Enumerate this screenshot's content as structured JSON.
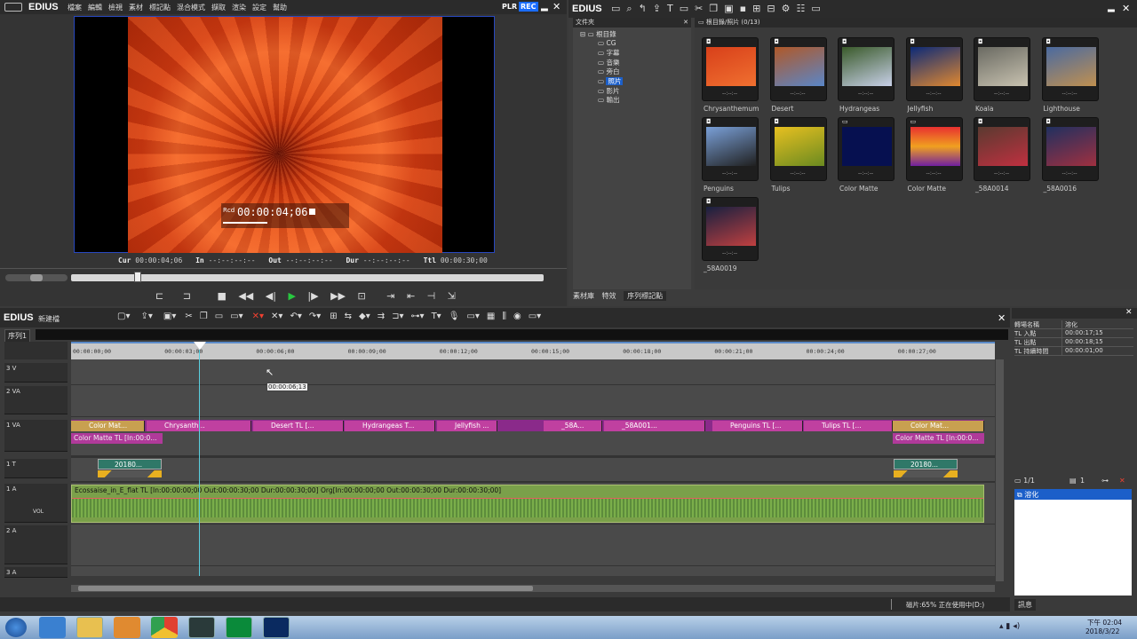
{
  "colors": {
    "accent": "#1c5fc9",
    "rec": "#1a6cff",
    "clip_pink": "#c040a0",
    "audio_green": "#7aa04a",
    "title_teal": "#3f8a7a"
  },
  "player": {
    "app_name": "EDIUS",
    "menu": [
      "檔案",
      "編輯",
      "檢視",
      "素材",
      "標記點",
      "混合模式",
      "擷取",
      "渲染",
      "設定",
      "幫助"
    ],
    "mode_plr": "PLR",
    "mode_rec": "REC",
    "overlay_label": "Rcd",
    "overlay_tc": "00:00:04;06",
    "cur_label": "Cur",
    "cur_value": "00:00:04;06",
    "in_label": "In",
    "in_value": "--:--:--:--",
    "out_label": "Out",
    "out_value": "--:--:--:--",
    "dur_label": "Dur",
    "dur_value": "--:--:--:--",
    "ttl_label": "Ttl",
    "ttl_value": "00:00:30;00"
  },
  "bin": {
    "app_name": "EDIUS",
    "folder_header": "文件夾",
    "path_header": "根目錄/照片 (0/13)",
    "tree": [
      "根目錄",
      "CG",
      "字幕",
      "音樂",
      "旁白",
      "照片",
      "影片",
      "輸出"
    ],
    "selected_folder": "照片",
    "items": [
      {
        "name": "Chrysanthemum",
        "thumb": "#d8401a",
        "thumb2": "#f07030",
        "icon": "camera-icon"
      },
      {
        "name": "Desert",
        "thumb": "#b05828",
        "thumb2": "#5a86c8",
        "icon": "camera-icon"
      },
      {
        "name": "Hydrangeas",
        "thumb": "#3a5a2a",
        "thumb2": "#c8d0e8",
        "icon": "camera-icon"
      },
      {
        "name": "Jellyfish",
        "thumb": "#0c2a78",
        "thumb2": "#e08830",
        "icon": "camera-icon"
      },
      {
        "name": "Koala",
        "thumb": "#6a6a62",
        "thumb2": "#c8c2b0",
        "icon": "camera-icon"
      },
      {
        "name": "Lighthouse",
        "thumb": "#4a6aa0",
        "thumb2": "#c09050",
        "icon": "camera-icon"
      },
      {
        "name": "Penguins",
        "thumb": "#7aa0d8",
        "thumb2": "#202020",
        "icon": "camera-icon"
      },
      {
        "name": "Tulips",
        "thumb": "#e8c020",
        "thumb2": "#6a8a20",
        "icon": "camera-icon"
      },
      {
        "name": "Color Matte",
        "thumb": "#061050",
        "thumb2": "#061050",
        "icon": "matte-icon"
      },
      {
        "name": "Color Matte",
        "thumb": "#e83030",
        "thumb2": "#5020a0",
        "icon": "matte-icon"
      },
      {
        "name": "_58A0014",
        "thumb": "#5a3a30",
        "thumb2": "#c03040",
        "icon": "camera-icon"
      },
      {
        "name": "_58A0016",
        "thumb": "#203060",
        "thumb2": "#a03040",
        "icon": "camera-icon"
      },
      {
        "name": "_58A0019",
        "thumb": "#182040",
        "thumb2": "#c04040",
        "icon": "camera-icon"
      }
    ],
    "thumb_tc": "--:--:--",
    "tabs": [
      "素材庫",
      "特效",
      "序列標記點"
    ]
  },
  "timeline": {
    "app_name": "EDIUS",
    "project_name": "新建檔",
    "sequence_tab": "序列1",
    "ruler": [
      "00:00:00;00",
      "00:00:03;00",
      "00:00:06;00",
      "00:00:09;00",
      "00:00:12;00",
      "00:00:15;00",
      "00:00:18;00",
      "00:00:21;00",
      "00:00:24;00",
      "00:00:27;00"
    ],
    "hover_tc": "00:00:06;13",
    "tracks": {
      "v3": "3 V",
      "v2": "2 VA",
      "v1": "1 VA",
      "t1": "1 T",
      "a1": "1 A",
      "a2": "2 A",
      "a3": "3 A"
    },
    "vol_label": "VOL",
    "v1_clips": [
      "Color Mat...",
      "Chrysanth...",
      "Desert  TL [...",
      "Hydrangeas  T...",
      "Jellyfish  ...",
      "_58A...",
      "_58A001...",
      "Penguins  TL [...",
      "Tulips  TL [...",
      "Color Mat..."
    ],
    "v1_audio_left": "Color Matte  TL [In:00:0...",
    "v1_audio_right": "Color Matte  TL [In:00:0...",
    "t1_clips": [
      "20180...",
      "20180..."
    ],
    "a1_clip": "Ecossaise_in_E_flat  TL [In:00:00:00;00  Out:00:00:30;00  Dur:00:00:30;00]  Org[In:00:00:00;00  Out:00:00:30;00  Dur:00:00:30;00]"
  },
  "info": {
    "rows": [
      {
        "k": "轉場名稱",
        "v": "溶化"
      },
      {
        "k": "TL 入點",
        "v": "00:00:17;15"
      },
      {
        "k": "TL 出點",
        "v": "00:00:18;15"
      },
      {
        "k": "TL 持續時間",
        "v": "00:00:01;00"
      }
    ],
    "page": "1/1",
    "count": "1",
    "effect": "溶化",
    "tab": "訊息"
  },
  "status": {
    "text": "磁片:65% 正在使用中(D:)"
  },
  "taskbar": {
    "time": "下午 02:04",
    "date": "2018/3/22"
  }
}
